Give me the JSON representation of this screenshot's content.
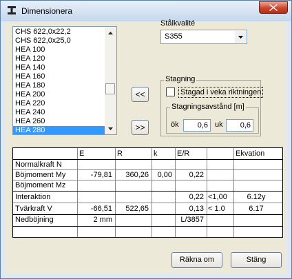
{
  "window": {
    "title": "Dimensionera"
  },
  "profiles": {
    "items": [
      "CHS 622,0x22,2",
      "CHS 622,0x25,0",
      "HEA 100",
      "HEA 120",
      "HEA 140",
      "HEA 160",
      "HEA 180",
      "HEA 200",
      "HEA 220",
      "HEA 240",
      "HEA 260",
      "HEA 280"
    ],
    "selected": "HEA 280"
  },
  "steel": {
    "label": "Stålkvalité",
    "value": "S355"
  },
  "bracing": {
    "group_title": "Stagning",
    "checkbox_label": "Stagad i veka riktningen",
    "checked": false,
    "spacing_title": "Stagningsavstånd [m]",
    "ok_label": "ök",
    "ok_value": "0,6",
    "uk_label": "uk",
    "uk_value": "0,6"
  },
  "transfer": {
    "add_label": "<<",
    "remove_label": ">>"
  },
  "results": {
    "headers": [
      "",
      "E",
      "R",
      "k",
      "E/R",
      "",
      "Ekvation"
    ],
    "rows": [
      [
        "Normalkraft N",
        "",
        "",
        "",
        "",
        "",
        ""
      ],
      [
        "Böjmoment   My",
        "-79,81",
        "360,26",
        "0,00",
        "0,22",
        "",
        ""
      ],
      [
        "Böjmoment   Mz",
        "",
        "",
        "",
        "",
        "",
        ""
      ],
      [
        "Interaktion",
        "",
        "",
        "",
        "0,22",
        "<1,00",
        "6.12y"
      ],
      [
        "Tvärkraft   V",
        "-66,51",
        "522,65",
        "",
        "0,13",
        "< 1.0",
        "6.17"
      ],
      [
        "Nedböjning",
        "2 mm",
        "",
        "",
        "L/3857",
        "",
        ""
      ]
    ]
  },
  "buttons": {
    "calculate": "Räkna om",
    "close": "Stäng"
  },
  "colors": {
    "selection": "#3399ff",
    "titlebar": "#c5d7ec",
    "close": "#c9452c"
  }
}
